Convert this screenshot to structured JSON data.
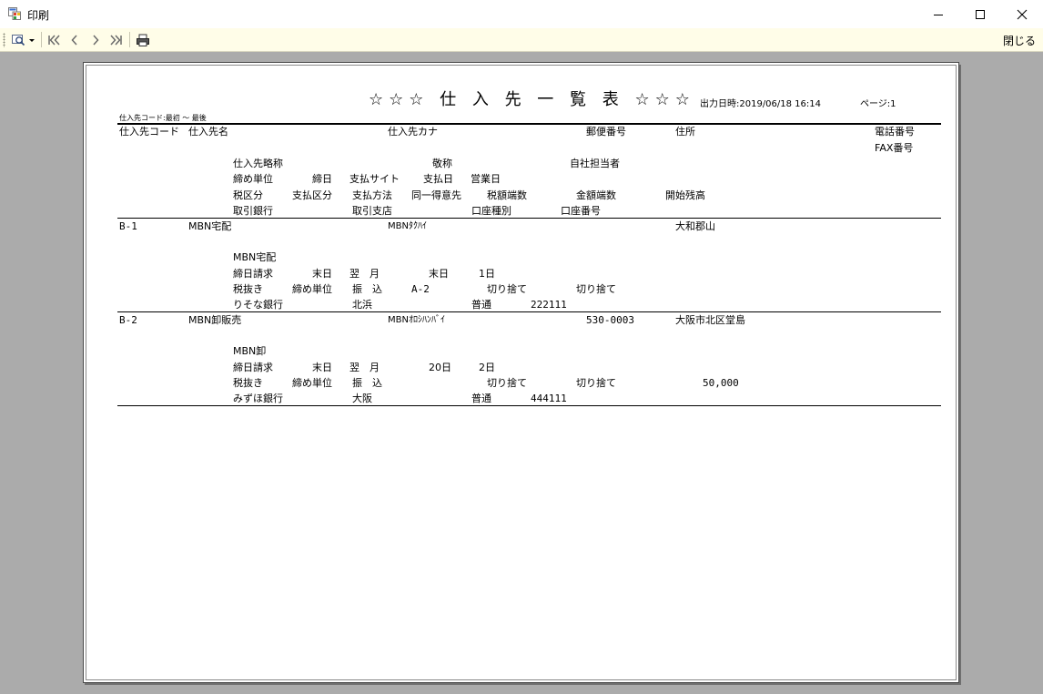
{
  "window": {
    "title": "印刷",
    "accent": "#fffde8"
  },
  "toolbar": {
    "close_label": "閉じる"
  },
  "report": {
    "title": "☆☆☆ 仕 入 先 一 覧 表 ☆☆☆",
    "output_datetime": "出力日時:2019/06/18 16:14",
    "page_no": "ページ:1",
    "range": "仕入先コード:最初 ～ 最後",
    "headers": {
      "code": "仕入先コード",
      "name": "仕入先名",
      "kana": "仕入先カナ",
      "postal": "郵便番号",
      "address": "住所",
      "phone": "電話番号",
      "fax": "FAX番号",
      "short_name": "仕入先略称",
      "honorific": "敬称",
      "staff": "自社担当者",
      "closing_unit": "締め単位",
      "closing_day": "締日",
      "pay_site": "支払サイト",
      "pay_day": "支払日",
      "business_day": "営業日",
      "tax_class": "税区分",
      "pay_class": "支払区分",
      "pay_method": "支払方法",
      "same_as": "同一得意先",
      "tax_rounding": "税額端数",
      "amount_rounding": "金額端数",
      "opening_balance": "開始残高",
      "bank": "取引銀行",
      "branch": "取引支店",
      "account_type": "口座種別",
      "account_no": "口座番号"
    },
    "records": [
      {
        "code": "B-1",
        "name": "MBN宅配",
        "kana": "MBNﾀｸﾊｲ",
        "postal": "",
        "address": "大和郡山",
        "short_name": "MBN宅配",
        "closing_unit": "締日請求",
        "closing_day": "末日",
        "pay_site": "翌　月",
        "pay_day": "末日",
        "business_day": "1日",
        "tax_class": "税抜き",
        "pay_class": "締め単位",
        "pay_method": "振　込",
        "same_as": "A-2",
        "tax_rounding": "切り捨て",
        "amount_rounding": "切り捨て",
        "opening_balance": "",
        "bank": "りそな銀行",
        "branch": "北浜",
        "account_type": "普通",
        "account_no": "222111"
      },
      {
        "code": "B-2",
        "name": "MBN卸販売",
        "kana": "MBNｵﾛｼﾊﾝﾊﾞｲ",
        "postal": "530-0003",
        "address": "大阪市北区堂島",
        "short_name": "MBN卸",
        "closing_unit": "締日請求",
        "closing_day": "末日",
        "pay_site": "翌　月",
        "pay_day": "20日",
        "business_day": "2日",
        "tax_class": "税抜き",
        "pay_class": "締め単位",
        "pay_method": "振　込",
        "same_as": "",
        "tax_rounding": "切り捨て",
        "amount_rounding": "切り捨て",
        "opening_balance": "50,000",
        "bank": "みずほ銀行",
        "branch": "大阪",
        "account_type": "普通",
        "account_no": "444111"
      }
    ]
  }
}
